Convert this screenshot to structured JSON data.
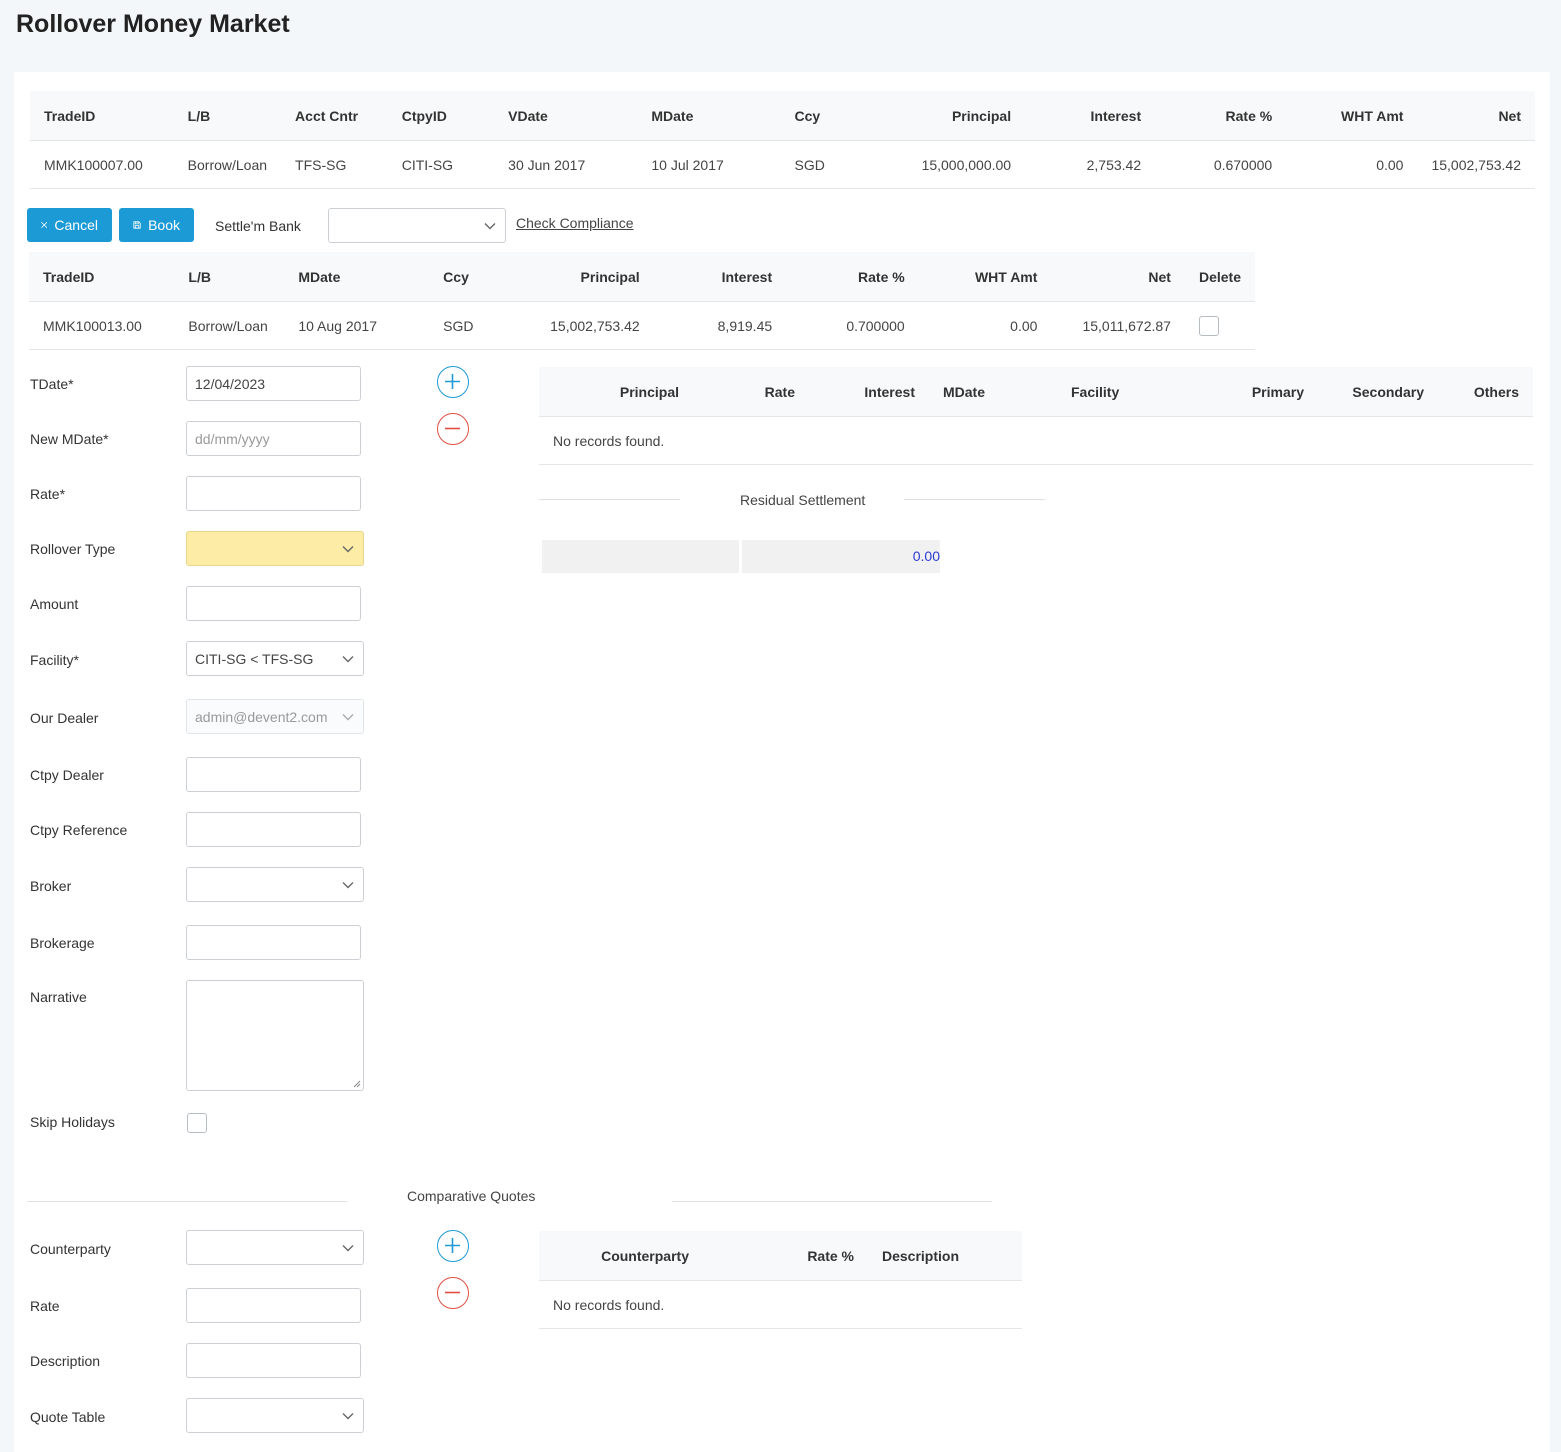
{
  "page_title": "Rollover Money Market",
  "source_table": {
    "headers": [
      "TradeID",
      "L/B",
      "Acct Cntr",
      "CtpyID",
      "VDate",
      "MDate",
      "Ccy",
      "Principal",
      "Interest",
      "Rate %",
      "WHT Amt",
      "Net"
    ],
    "row": [
      "MMK100007.00",
      "Borrow/Loan",
      "TFS-SG",
      "CITI-SG",
      "30 Jun 2017",
      "10 Jul 2017",
      "SGD",
      "15,000,000.00",
      "2,753.42",
      "0.670000",
      "0.00",
      "15,002,753.42"
    ]
  },
  "toolbar": {
    "cancel_label": "Cancel",
    "book_label": "Book",
    "settle_bank_label": "Settle'm Bank",
    "settle_bank_value": "",
    "check_compliance_label": "Check Compliance"
  },
  "rollover_table": {
    "headers": [
      "TradeID",
      "L/B",
      "MDate",
      "Ccy",
      "Principal",
      "Interest",
      "Rate %",
      "WHT Amt",
      "Net",
      "Delete"
    ],
    "row": [
      "MMK100013.00",
      "Borrow/Loan",
      "10 Aug 2017",
      "SGD",
      "15,002,753.42",
      "8,919.45",
      "0.700000",
      "0.00",
      "15,011,672.87"
    ]
  },
  "form": {
    "tdate_label": "TDate*",
    "tdate_value": "12/04/2023",
    "new_mdate_label": "New MDate*",
    "new_mdate_placeholder": "dd/mm/yyyy",
    "rate_label": "Rate*",
    "rate_value": "",
    "rollover_type_label": "Rollover Type",
    "rollover_type_value": "",
    "amount_label": "Amount",
    "amount_value": "",
    "facility_label": "Facility*",
    "facility_value": "CITI-SG < TFS-SG",
    "our_dealer_label": "Our Dealer",
    "our_dealer_value": "admin@devent2.com",
    "ctpy_dealer_label": "Ctpy Dealer",
    "ctpy_dealer_value": "",
    "ctpy_reference_label": "Ctpy Reference",
    "ctpy_reference_value": "",
    "broker_label": "Broker",
    "broker_value": "",
    "brokerage_label": "Brokerage",
    "brokerage_value": "",
    "narrative_label": "Narrative",
    "narrative_value": "",
    "skip_holidays_label": "Skip Holidays"
  },
  "schedule_table": {
    "headers": [
      "Principal",
      "Rate",
      "Interest",
      "MDate",
      "Facility",
      "Primary",
      "Secondary",
      "Others"
    ],
    "empty_message": "No records found."
  },
  "residual": {
    "title": "Residual Settlement",
    "value": "0.00"
  },
  "quotes": {
    "title": "Comparative Quotes",
    "counterparty_label": "Counterparty",
    "counterparty_value": "",
    "rate_label": "Rate",
    "rate_value": "",
    "description_label": "Description",
    "description_value": "",
    "quote_table_label": "Quote Table",
    "quote_table_value": "",
    "headers": [
      "Counterparty",
      "Rate %",
      "Description"
    ],
    "empty_message": "No records found."
  },
  "colors": {
    "accent": "#1c9ad6",
    "danger": "#e05040",
    "highlight": "#fdeca6",
    "link_value": "#2b3bd0"
  }
}
